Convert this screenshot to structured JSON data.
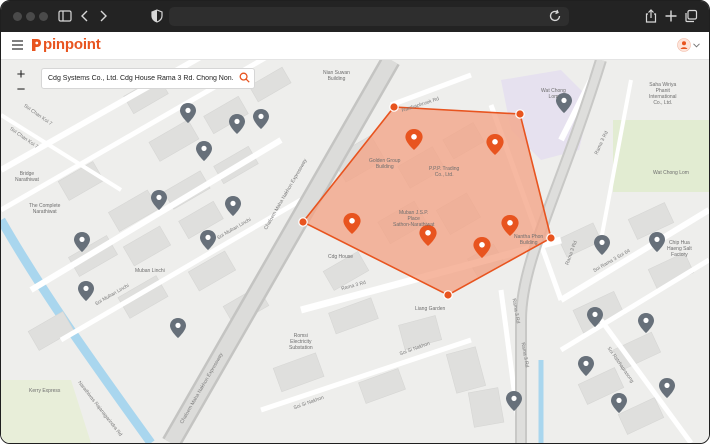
{
  "app": {
    "brand": "pinpoint"
  },
  "search": {
    "value": "Cdg Systems Co., Ltd. Cdg House Rama 3 Rd. Chong Non..."
  },
  "zoom": {
    "in_label": "+",
    "out_label": "−"
  },
  "colors": {
    "brand": "#e8541f",
    "polygon_fill": "#f4a486",
    "pin_gray": "#67707a",
    "pin_orange": "#e8541f"
  },
  "icons": [
    "sidebar-icon",
    "back-icon",
    "forward-icon",
    "shield-icon",
    "reload-icon",
    "share-icon",
    "new-tab-icon",
    "tabs-icon",
    "menu-icon",
    "search-icon",
    "avatar-icon",
    "chevron-down-icon",
    "map-pin-icon"
  ],
  "map": {
    "places": {
      "nian_suwan": "Nian Suwan\nBuilding",
      "wat_chong_lom_bldg": "Wat Chong\nLom",
      "saha_wiriya": "Saha Wiriya\nPhanit\nInternational\nCo., Ltd.",
      "wat_chong_lom": "Wat Chong Lom",
      "golden_group": "Golden Group\nBuilding",
      "ppp_trading": "P.P.P. Trading\nCo., Ltd.",
      "muban_lsp": "Muban J.S.P.\nPlace\nSathon-Narathiwat",
      "nantha_phon": "Nantha Phon\nBuilding",
      "bridge_narathiwat": "Bridge\nNarathiwat",
      "complete_narathiwat": "The Complete\nNarathiwat",
      "muban_linchi": "Muban Linchi",
      "cdg_house": "Cdg House",
      "chip_hua": "Chip Hua\nHaeng Salt\nFactory",
      "liang_garden": "Liang Garden",
      "rom_substation": "Romsi\nElectricity\nSubstation",
      "kerry_express": "Kerry Express"
    },
    "roads": {
      "chaloem_expressway": "Chaloem Maha Nakhon Expressway",
      "chaloem_expressway_2": "Chaloem Maha Nakhon Expressway",
      "rama3_a": "Rama 3 Rd",
      "rama3_b": "Rama 3 Rd",
      "rama3_c": "Rama 3 Rd",
      "rama3_d": "Rama 3 Rd",
      "rama3_e": "Rama 3 Rd",
      "soi_chan_koi_7": "Soi Chan Koi 7",
      "soi_chan_koi_7b": "Soi Chan Koi 7",
      "soi_muban_linchi": "Soi Muban Linchi",
      "soi_muban_linchi_b": "Soi Muban Linchi",
      "narathiwat": "Narathiwas Rajanagarindra Rd",
      "soi_si_nakhon": "Soi Si Nakhon",
      "soi_si_nakhon_b": "Soi Si Nakhon",
      "soi_rama3_64": "Soi Rama 3 Soi 64",
      "soi_ratchap": "Soi Ratchaprasong",
      "ratchaphruek": "Ratchaphruek Rd"
    }
  }
}
